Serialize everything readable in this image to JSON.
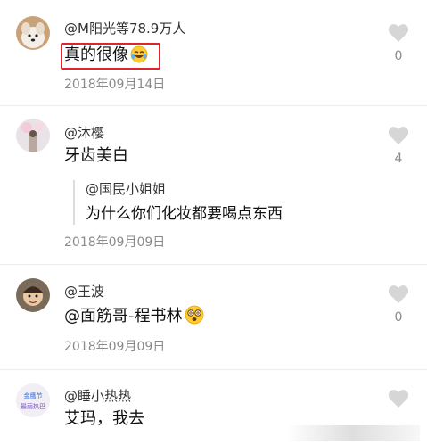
{
  "comments": [
    {
      "username": "@M阳光等78.9万人",
      "text": "真的很像",
      "date": "2018年09月14日",
      "likes": "0",
      "emoji": "laugh-cry-icon"
    },
    {
      "username": "@沐樱",
      "text": "牙齿美白",
      "date": "2018年09月09日",
      "likes": "4",
      "reply": {
        "username": "@国民小姐姐",
        "text": "为什么你们化妆都要喝点东西"
      }
    },
    {
      "username": "@王波",
      "text": "@面筋哥-程书林",
      "date": "2018年09月09日",
      "likes": "0",
      "emoji": "dizzy-face-icon"
    },
    {
      "username": "@睡小热热",
      "text": "艾玛，我去",
      "likes": ""
    }
  ],
  "avatar4_text": "金鹰节 · 最丽热巴",
  "colors": {
    "highlight": "#e0262b",
    "heart": "#d6d6d6",
    "meta": "#8a8a8a"
  }
}
